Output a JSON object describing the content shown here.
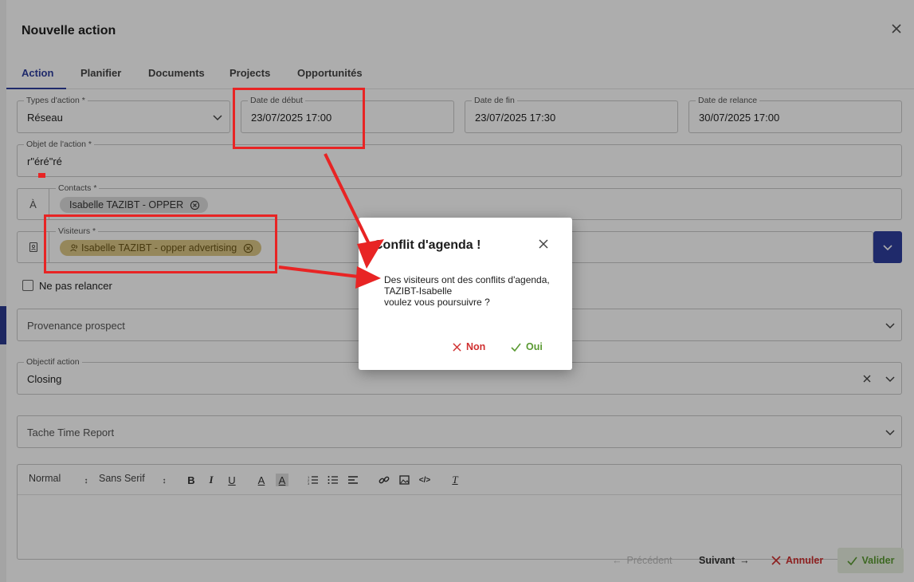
{
  "modal": {
    "title": "Nouvelle action",
    "tabs": [
      {
        "label": "Action"
      },
      {
        "label": "Planifier"
      },
      {
        "label": "Documents"
      },
      {
        "label": "Projects"
      },
      {
        "label": "Opportunités"
      }
    ]
  },
  "form": {
    "type_action": {
      "label": "Types d'action *",
      "value": "Réseau"
    },
    "date_debut": {
      "label": "Date de début",
      "value": "23/07/2025 17:00"
    },
    "date_fin": {
      "label": "Date de fin",
      "value": "23/07/2025 17:30"
    },
    "date_relance": {
      "label": "Date de relance",
      "value": "30/07/2025 17:00"
    },
    "objet": {
      "label": "Objet de l'action *",
      "value": "r\"éré\"ré"
    },
    "contacts": {
      "label": "Contacts *",
      "prefix": "À",
      "chip": "Isabelle TAZIBT - OPPER"
    },
    "visiteurs": {
      "label": "Visiteurs *",
      "chip": "Isabelle TAZIBT - opper advertising"
    },
    "ne_pas_relancer": {
      "label": "Ne pas relancer",
      "checked": false
    },
    "provenance": {
      "placeholder": "Provenance prospect"
    },
    "objectif": {
      "label": "Objectif action",
      "value": "Closing"
    },
    "tache": {
      "placeholder": "Tache Time Report"
    }
  },
  "editor": {
    "format": "Normal",
    "font": "Sans Serif"
  },
  "footer": {
    "precedent": "Précédent",
    "suivant": "Suivant",
    "annuler": "Annuler",
    "valider": "Valider"
  },
  "dialog": {
    "title": "Conflit d'agenda !",
    "message_line1": "Des visiteurs ont des conflits d'agenda,",
    "message_line2": "TAZIBT-Isabelle",
    "message_line3": "voulez vous poursuivre ?",
    "no_label": "Non",
    "yes_label": "Oui"
  },
  "colors": {
    "primary": "#2f3e9e",
    "danger": "#d03030",
    "success": "#5a9a32",
    "annotation": "#e82424",
    "chip_gold": "#dcc787"
  }
}
